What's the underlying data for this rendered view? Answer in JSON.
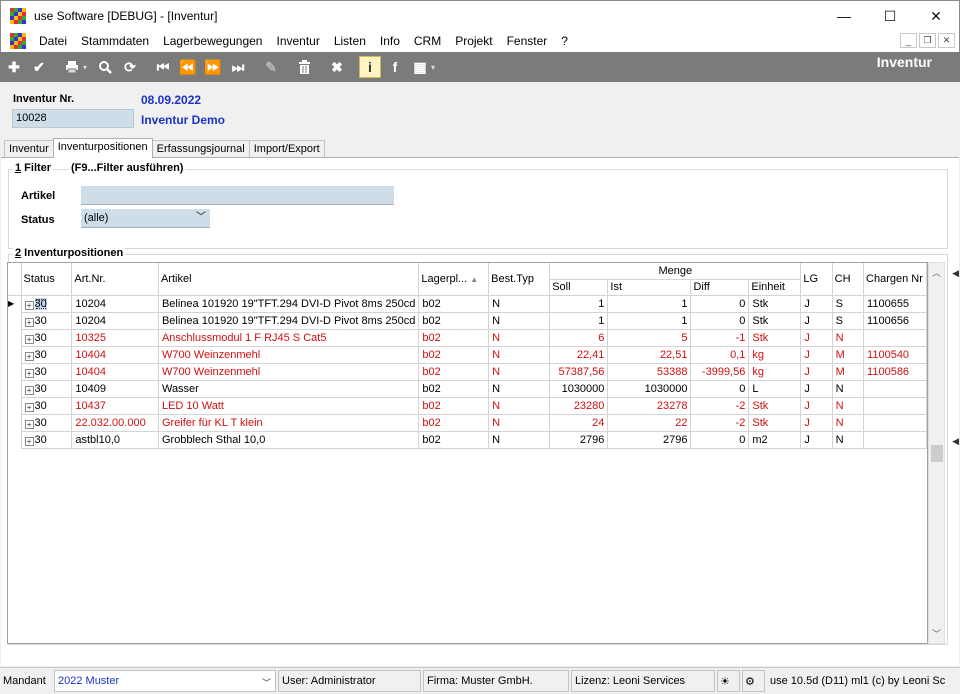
{
  "window": {
    "title": "use Software [DEBUG] - [Inventur]",
    "minimize": "—",
    "maximize": "☐",
    "close": "✕"
  },
  "menu": [
    "Datei",
    "Stammdaten",
    "Lagerbewegungen",
    "Inventur",
    "Listen",
    "Info",
    "CRM",
    "Projekt",
    "Fenster",
    "?"
  ],
  "mdi": {
    "minimize": "_",
    "restore": "❐",
    "close": "✕"
  },
  "toolbar": {
    "title": "Inventur"
  },
  "header": {
    "inventur_label": "Inventur Nr.",
    "inventur_value": "10028",
    "date": "08.09.2022",
    "name": "Inventur Demo"
  },
  "tabs": [
    "Inventur",
    "Inventurpositionen",
    "Erfassungsjournal",
    "Import/Export"
  ],
  "active_tab": "Inventurpositionen",
  "filter": {
    "title_num": "1",
    "title_rest": " Filter",
    "hint": "(F9...Filter ausführen)",
    "artikel_label": "Artikel",
    "artikel_value": "",
    "status_label": "Status",
    "status_value": "(alle)"
  },
  "positions": {
    "title_num": "2",
    "title_rest": " Inventurpositionen",
    "group_header": "Menge",
    "columns": [
      "Status",
      "Art.Nr.",
      "Artikel",
      "Lagerpl...",
      "Best.Typ",
      "Soll",
      "Ist",
      "Diff",
      "Einheit",
      "LG",
      "CH",
      "Chargen Nr"
    ],
    "rows": [
      {
        "status": "30",
        "artnr": "10204",
        "artikel": "Belinea 101920 19\"TFT.294 DVI-D Pivot 8ms 250cd",
        "lager": "b02",
        "best": "N",
        "soll": "1",
        "ist": "1",
        "diff": "0",
        "einheit": "Stk",
        "lg": "J",
        "ch": "S",
        "charge": "1100655",
        "red": false
      },
      {
        "status": "30",
        "artnr": "10204",
        "artikel": "Belinea 101920 19\"TFT.294 DVI-D Pivot 8ms 250cd",
        "lager": "b02",
        "best": "N",
        "soll": "1",
        "ist": "1",
        "diff": "0",
        "einheit": "Stk",
        "lg": "J",
        "ch": "S",
        "charge": "1100656",
        "red": false
      },
      {
        "status": "30",
        "artnr": "10325",
        "artikel": "Anschlussmodul 1 F RJ45 S Cat5",
        "lager": "b02",
        "best": "N",
        "soll": "6",
        "ist": "5",
        "diff": "-1",
        "einheit": "Stk",
        "lg": "J",
        "ch": "N",
        "charge": "",
        "red": true
      },
      {
        "status": "30",
        "artnr": "10404",
        "artikel": "W700 Weinzenmehl",
        "lager": "b02",
        "best": "N",
        "soll": "22,41",
        "ist": "22,51",
        "diff": "0,1",
        "einheit": "kg",
        "lg": "J",
        "ch": "M",
        "charge": "1100540",
        "red": true
      },
      {
        "status": "30",
        "artnr": "10404",
        "artikel": "W700 Weinzenmehl",
        "lager": "b02",
        "best": "N",
        "soll": "57387,56",
        "ist": "53388",
        "diff": "-3999,56",
        "einheit": "kg",
        "lg": "J",
        "ch": "M",
        "charge": "1100586",
        "red": true
      },
      {
        "status": "30",
        "artnr": "10409",
        "artikel": "Wasser",
        "lager": "b02",
        "best": "N",
        "soll": "1030000",
        "ist": "1030000",
        "diff": "0",
        "einheit": "L",
        "lg": "J",
        "ch": "N",
        "charge": "",
        "red": false
      },
      {
        "status": "30",
        "artnr": "10437",
        "artikel": "LED 10 Watt",
        "lager": "b02",
        "best": "N",
        "soll": "23280",
        "ist": "23278",
        "diff": "-2",
        "einheit": "Stk",
        "lg": "J",
        "ch": "N",
        "charge": "",
        "red": true
      },
      {
        "status": "30",
        "artnr": "22.032.00.000",
        "artikel": "Greifer für KL T klein",
        "lager": "b02",
        "best": "N",
        "soll": "24",
        "ist": "22",
        "diff": "-2",
        "einheit": "Stk",
        "lg": "J",
        "ch": "N",
        "charge": "",
        "red": true
      },
      {
        "status": "30",
        "artnr": "astbl10,0",
        "artikel": "Grobblech Sthal 10,0",
        "lager": "b02",
        "best": "N",
        "soll": "2796",
        "ist": "2796",
        "diff": "0",
        "einheit": "m2",
        "lg": "J",
        "ch": "N",
        "charge": "",
        "red": false
      }
    ]
  },
  "statusbar": {
    "mandant_label": "Mandant",
    "mandant_value": "2022 Muster",
    "user": "User: Administrator",
    "firma": "Firma: Muster GmbH.",
    "lizenz": "Lizenz: Leoni Services",
    "version": "use 10.5d (D11) ml1 (c) by Leoni Sc"
  },
  "colors": {
    "toolbar_bg": "#7b7b7b",
    "accent_blue": "#1a33c7",
    "row_red": "#d01010",
    "input_bg": "#cfdde9"
  }
}
